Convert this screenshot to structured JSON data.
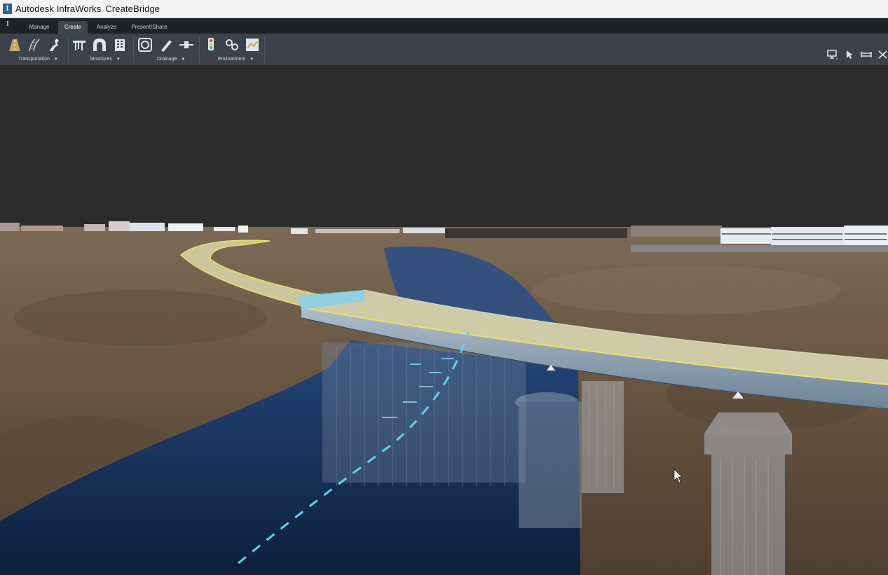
{
  "titlebar": {
    "app_name": "Autodesk InfraWorks",
    "document": "CreateBridge",
    "logo_letter": "I"
  },
  "tabs": [
    {
      "label": "Manage",
      "active": false
    },
    {
      "label": "Create",
      "active": true
    },
    {
      "label": "Analyze",
      "active": false
    },
    {
      "label": "Present/Share",
      "active": false
    }
  ],
  "ribbon": {
    "groups": [
      {
        "label": "Transportation",
        "icons": [
          "road-icon",
          "rail-icon",
          "component-road-icon"
        ]
      },
      {
        "label": "Structures",
        "icons": [
          "bridge-icon",
          "tunnel-icon",
          "building-icon"
        ]
      },
      {
        "label": "Drainage",
        "icons": [
          "pipe-network-icon",
          "culvert-icon",
          "pipe-connector-icon"
        ]
      },
      {
        "label": "Environment",
        "icons": [
          "traffic-signal-icon",
          "city-furniture-icon",
          "land-area-icon"
        ]
      }
    ],
    "right_tools": [
      "display-icon",
      "select-icon",
      "measure-icon",
      "close-tools-icon"
    ]
  },
  "colors": {
    "titlebar_bg": "#f4f4f4",
    "tabrow_bg": "#1e2227",
    "ribbon_bg": "#3b424b",
    "sky": "#2b2b2b",
    "terrain": "#6b5a46",
    "water": "#0f2545",
    "road": "#c9c39a",
    "bridge_steel": "#8fa3b8",
    "accent_cyan": "#5fd3f0"
  }
}
